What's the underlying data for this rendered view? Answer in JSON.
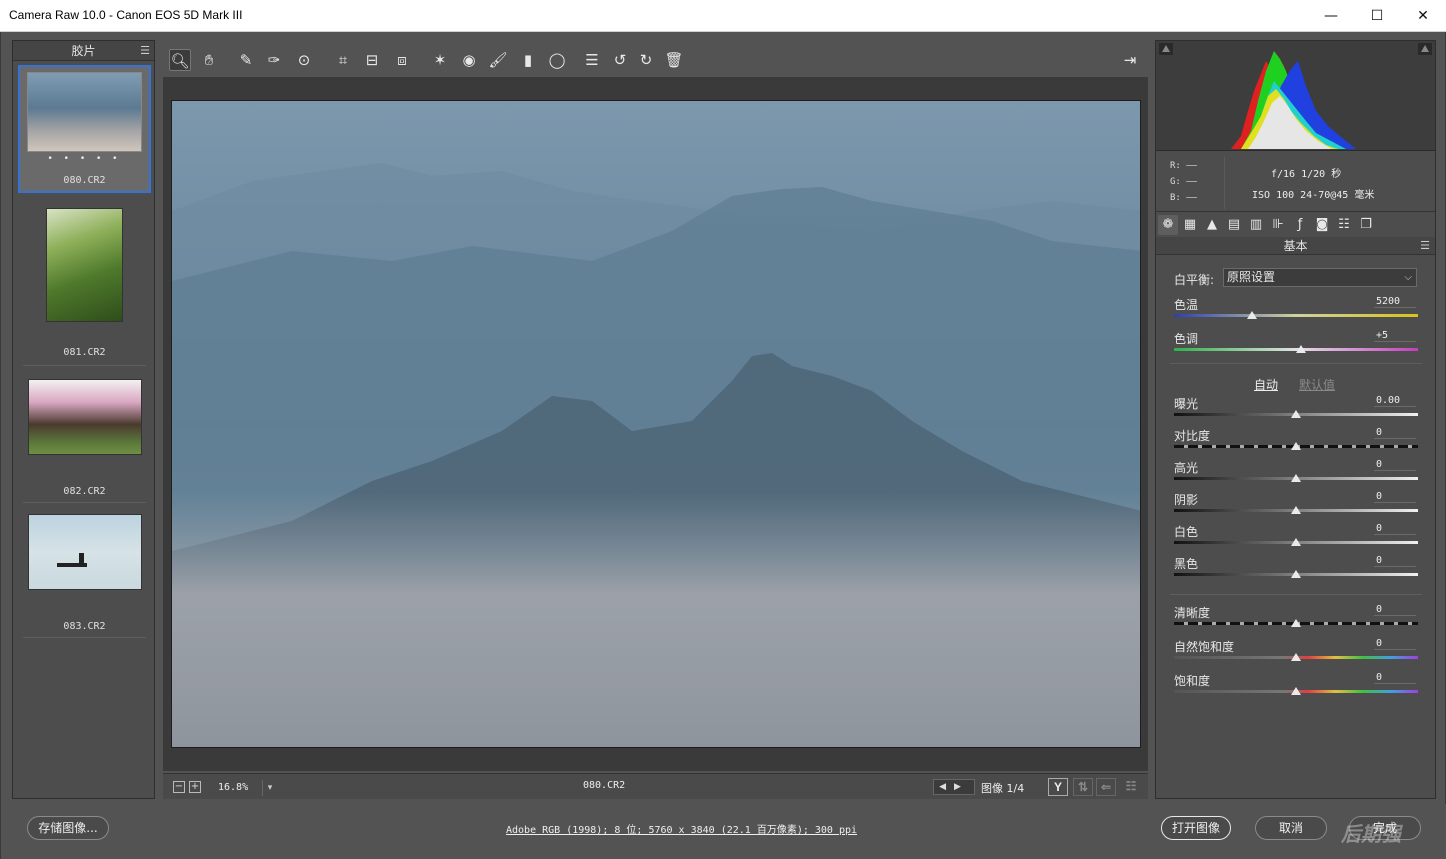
{
  "window": {
    "title": "Camera Raw 10.0 -  Canon EOS 5D Mark III"
  },
  "filmstrip": {
    "header": "胶片",
    "items": [
      {
        "name": "080.CR2",
        "selected": true,
        "rating_dots": "• • • • •"
      },
      {
        "name": "081.CR2",
        "selected": false
      },
      {
        "name": "082.CR2",
        "selected": false
      },
      {
        "name": "083.CR2",
        "selected": false
      }
    ]
  },
  "toolbar": {
    "tools": [
      {
        "name": "zoom-tool",
        "icon": "magnifier-icon",
        "glyph": "🔍︎"
      },
      {
        "name": "hand-tool",
        "icon": "hand-icon",
        "glyph": "✋︎"
      },
      {
        "name": "white-balance-tool",
        "icon": "eyedropper-icon",
        "glyph": "✎"
      },
      {
        "name": "color-sampler-tool",
        "icon": "eyedropper-plus-icon",
        "glyph": "✑"
      },
      {
        "name": "targeted-adjustment-tool",
        "icon": "target-icon",
        "glyph": "⊙"
      },
      {
        "name": "crop-tool",
        "icon": "crop-icon",
        "glyph": "⌗"
      },
      {
        "name": "straighten-tool",
        "icon": "level-icon",
        "glyph": "⊟"
      },
      {
        "name": "transform-tool",
        "icon": "transform-icon",
        "glyph": "⧈"
      },
      {
        "name": "spot-removal-tool",
        "icon": "spot-icon",
        "glyph": "✶"
      },
      {
        "name": "red-eye-tool",
        "icon": "eye-icon",
        "glyph": "◉"
      },
      {
        "name": "adjustment-brush-tool",
        "icon": "brush-icon",
        "glyph": "🖌︎"
      },
      {
        "name": "graduated-filter-tool",
        "icon": "gradient-icon",
        "glyph": "▮"
      },
      {
        "name": "radial-filter-tool",
        "icon": "ellipse-icon",
        "glyph": "◯"
      },
      {
        "name": "preferences-tool",
        "icon": "list-icon",
        "glyph": "☰"
      },
      {
        "name": "rotate-left-tool",
        "icon": "rotate-ccw-icon",
        "glyph": "↺"
      },
      {
        "name": "rotate-right-tool",
        "icon": "rotate-cw-icon",
        "glyph": "↻"
      },
      {
        "name": "delete-tool",
        "icon": "trash-icon",
        "glyph": "🗑︎"
      }
    ],
    "fullscreen_icon": "fullscreen-icon"
  },
  "canvas_bar": {
    "zoom": "16.8%",
    "file": "080.CR2",
    "image_counter": "图像 1/4",
    "view_button": "Y"
  },
  "histogram": {
    "r": "R: ——",
    "g": "G: ——",
    "b": "B: ——",
    "exif_line1": "f/16   1/20 秒",
    "exif_line2": "ISO 100   24-70@45 毫米"
  },
  "panel": {
    "title": "基本",
    "white_balance_label": "白平衡:",
    "white_balance_value": "原照设置",
    "auto": "自动",
    "default": "默认值",
    "sliders": [
      {
        "label": "色温",
        "value": "5200",
        "pos": 0.32,
        "kind": "temp"
      },
      {
        "label": "色调",
        "value": "+5",
        "pos": 0.52,
        "kind": "tint"
      },
      {
        "label": "曝光",
        "value": "0.00",
        "pos": 0.5,
        "kind": "gray"
      },
      {
        "label": "对比度",
        "value": "0",
        "pos": 0.5,
        "kind": "clar"
      },
      {
        "label": "高光",
        "value": "0",
        "pos": 0.5,
        "kind": "gray"
      },
      {
        "label": "阴影",
        "value": "0",
        "pos": 0.5,
        "kind": "gray"
      },
      {
        "label": "白色",
        "value": "0",
        "pos": 0.5,
        "kind": "gray"
      },
      {
        "label": "黑色",
        "value": "0",
        "pos": 0.5,
        "kind": "gray"
      },
      {
        "label": "清晰度",
        "value": "0",
        "pos": 0.5,
        "kind": "clar"
      },
      {
        "label": "自然饱和度",
        "value": "0",
        "pos": 0.5,
        "kind": "sat"
      },
      {
        "label": "饱和度",
        "value": "0",
        "pos": 0.5,
        "kind": "sat"
      }
    ]
  },
  "footer": {
    "save": "存储图像...",
    "info": "Adobe RGB (1998); 8 位; 5760 x 3840 (22.1 百万像素); 300 ppi",
    "open": "打开图像",
    "cancel": "取消",
    "done": "完成",
    "watermark": "后期强"
  }
}
